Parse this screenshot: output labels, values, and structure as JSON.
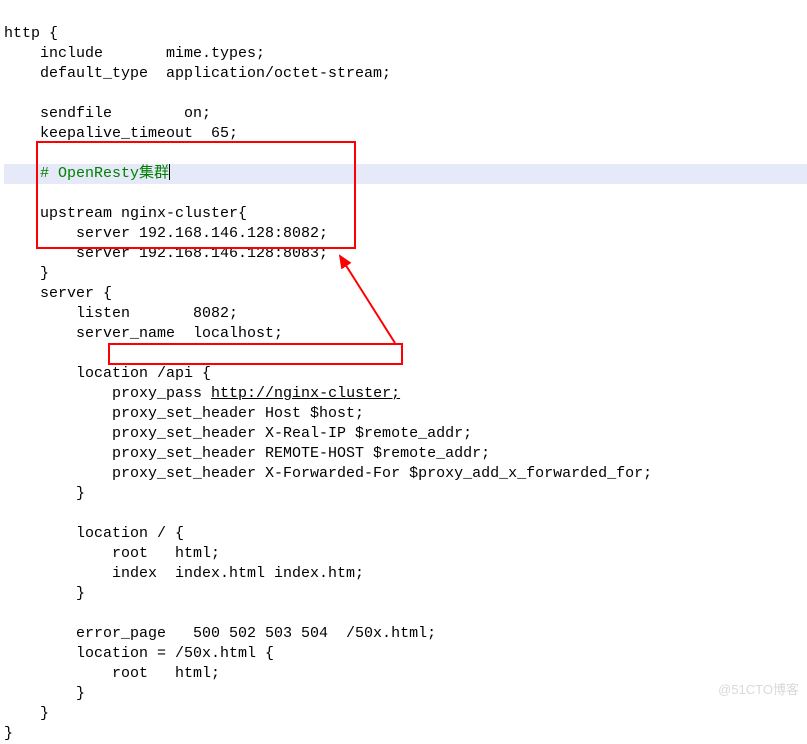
{
  "code": {
    "l1": "http {",
    "l2": "    include       mime.types;",
    "l3": "    default_type  application/octet-stream;",
    "l4": "",
    "l5": "    sendfile        on;",
    "l6": "    keepalive_timeout  65;",
    "l7": "",
    "l8a": "    ",
    "l8b": "# OpenResty集群",
    "l9": "    upstream nginx-cluster{",
    "l10": "        server 192.168.146.128:8082;",
    "l11": "        server 192.168.146.128:8083;",
    "l12": "    }",
    "l13": "    server {",
    "l14": "        listen       8082;",
    "l15": "        server_name  localhost;",
    "l16": "",
    "l17": "        location /api {",
    "l18a": "            proxy_pass ",
    "l18b": "http://nginx-cluster;",
    "l19": "            proxy_set_header Host $host;",
    "l20": "            proxy_set_header X-Real-IP $remote_addr;",
    "l21": "            proxy_set_header REMOTE-HOST $remote_addr;",
    "l22": "            proxy_set_header X-Forwarded-For $proxy_add_x_forwarded_for;",
    "l23": "        }",
    "l24": "",
    "l25": "        location / {",
    "l26": "            root   html;",
    "l27": "            index  index.html index.htm;",
    "l28": "        }",
    "l29": "",
    "l30": "        error_page   500 502 503 504  /50x.html;",
    "l31": "        location = /50x.html {",
    "l32": "            root   html;",
    "l33": "        }",
    "l34": "    }",
    "l35": "}"
  },
  "watermark": "@51CTO博客"
}
